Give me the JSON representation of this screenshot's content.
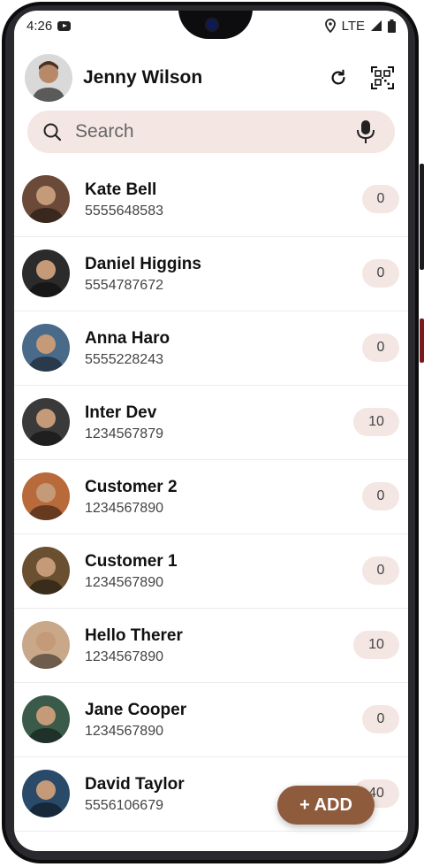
{
  "status": {
    "time": "4:26",
    "network": "LTE"
  },
  "header": {
    "user_name": "Jenny Wilson"
  },
  "search": {
    "placeholder": "Search"
  },
  "contacts": [
    {
      "name": "Kate Bell",
      "phone": "5555648583",
      "count": "0",
      "avatar_color": "#6b4a3a"
    },
    {
      "name": "Daniel Higgins",
      "phone": "5554787672",
      "count": "0",
      "avatar_color": "#2b2b2b"
    },
    {
      "name": "Anna Haro",
      "phone": "5555228243",
      "count": "0",
      "avatar_color": "#4a6a8a"
    },
    {
      "name": "Inter Dev",
      "phone": "1234567879",
      "count": "10",
      "avatar_color": "#3a3a3a"
    },
    {
      "name": "Customer 2",
      "phone": "1234567890",
      "count": "0",
      "avatar_color": "#b86a3a"
    },
    {
      "name": "Customer 1",
      "phone": "1234567890",
      "count": "0",
      "avatar_color": "#6a5030"
    },
    {
      "name": "Hello  Therer",
      "phone": "1234567890",
      "count": "10",
      "avatar_color": "#c9a88a"
    },
    {
      "name": "Jane Cooper",
      "phone": "1234567890",
      "count": "0",
      "avatar_color": "#3a5a4a"
    },
    {
      "name": "David Taylor",
      "phone": "5556106679",
      "count": "40",
      "avatar_color": "#2a4a6a"
    }
  ],
  "fab": {
    "label": "+ ADD"
  },
  "colors": {
    "accent": "#8e5b3c",
    "badge_bg": "#f3e6e3",
    "search_bg": "#f3e6e3"
  }
}
